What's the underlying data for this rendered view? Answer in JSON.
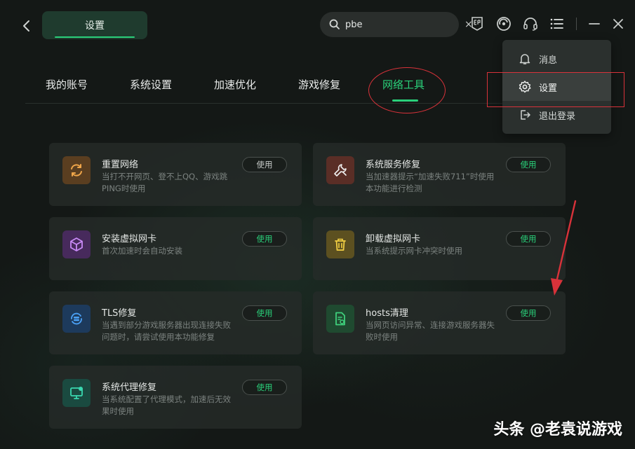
{
  "header": {
    "title": "设置",
    "search": {
      "value": "pbe",
      "clear": "×"
    }
  },
  "tabs": [
    {
      "label": "我的账号"
    },
    {
      "label": "系统设置"
    },
    {
      "label": "加速优化"
    },
    {
      "label": "游戏修复"
    },
    {
      "label": "网络工具",
      "active": true
    }
  ],
  "tools": [
    {
      "title": "重置网络",
      "desc": "当打不开网页、登不上QQ、游戏跳PING时使用",
      "button": "使用",
      "icon": "refresh-icon",
      "color": "#e59a3c"
    },
    {
      "title": "系统服务修复",
      "desc": "当加速器提示“加速失败711”时使用本功能进行检测",
      "button": "使用",
      "icon": "wrench-icon",
      "color": "#e46a4f"
    },
    {
      "title": "安装虚拟网卡",
      "desc": "首次加速时会自动安装",
      "button": "使用",
      "icon": "cube-icon",
      "color": "#b66cf0"
    },
    {
      "title": "卸载虚拟网卡",
      "desc": "当系统提示网卡冲突时使用",
      "button": "使用",
      "icon": "trash-icon",
      "color": "#e8c53a"
    },
    {
      "title": "TLS修复",
      "desc": "当遇到部分游戏服务器出现连接失败问题时，请尝试使用本功能修复",
      "button": "使用",
      "icon": "server-sync-icon",
      "color": "#3f93ea"
    },
    {
      "title": "hosts清理",
      "desc": "当网页访问异常、连接游戏服务器失败时使用",
      "button": "使用",
      "icon": "file-clean-icon",
      "color": "#36c070"
    },
    {
      "title": "系统代理修复",
      "desc": "当系统配置了代理模式，加速后无效果时使用",
      "button": "使用",
      "icon": "monitor-icon",
      "color": "#2ec9a0"
    }
  ],
  "menu": {
    "items": [
      {
        "label": "消息",
        "icon": "bell-icon"
      },
      {
        "label": "设置",
        "icon": "gear-icon",
        "selected": true
      },
      {
        "label": "退出登录",
        "icon": "logout-icon"
      }
    ]
  },
  "watermark": "头条 @老袁说游戏",
  "colors": {
    "accent": "#2ad07a",
    "annotation": "#d8323a",
    "background": "#141816"
  }
}
